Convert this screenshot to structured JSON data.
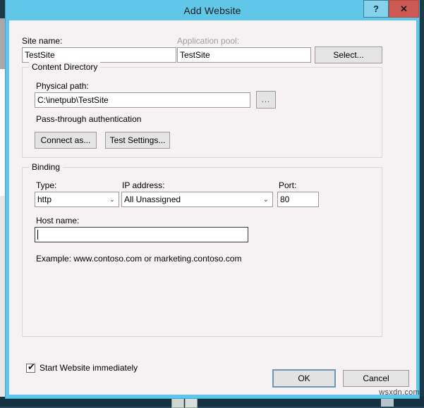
{
  "window": {
    "title": "Add Website",
    "help_button": "?",
    "close_button": "✕"
  },
  "form": {
    "site_name_label": "Site name:",
    "site_name_value": "TestSite",
    "app_pool_label": "Application pool:",
    "app_pool_value": "TestSite",
    "select_button": "Select..."
  },
  "content_directory": {
    "group_title": "Content Directory",
    "physical_path_label": "Physical path:",
    "physical_path_value": "C:\\inetpub\\TestSite",
    "browse_button": "...",
    "auth_text": "Pass-through authentication",
    "connect_as_button": "Connect as...",
    "test_settings_button": "Test Settings..."
  },
  "binding": {
    "group_title": "Binding",
    "type_label": "Type:",
    "type_value": "http",
    "ip_label": "IP address:",
    "ip_value": "All Unassigned",
    "port_label": "Port:",
    "port_value": "80",
    "host_name_label": "Host name:",
    "host_name_value": "",
    "example_text": "Example: www.contoso.com or marketing.contoso.com",
    "dropdown_arrow": "⌄"
  },
  "footer": {
    "start_immediately_label": "Start Website immediately",
    "start_immediately_checked": true,
    "checkmark": "✔",
    "ok_button": "OK",
    "cancel_button": "Cancel"
  },
  "watermark": "wsxdn.com"
}
